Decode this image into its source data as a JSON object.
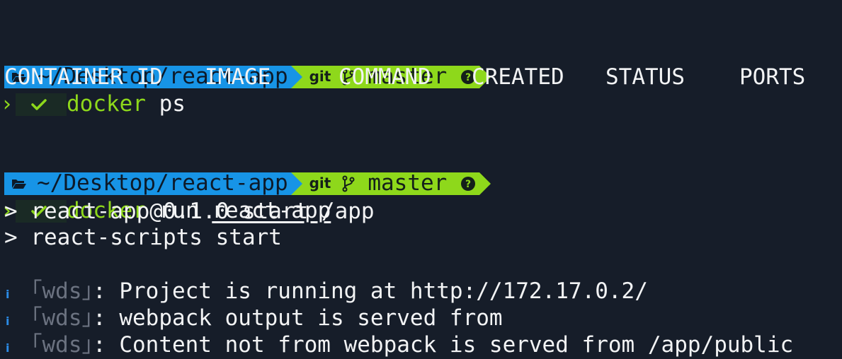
{
  "prompt1": {
    "path": "~/Desktop/react-app",
    "vcs": "git",
    "branch": "master",
    "command_word": "docker",
    "command_rest": " ps"
  },
  "ps_header": [
    "CONTAINER ID",
    "IMAGE",
    "COMMAND",
    "CREATED",
    "STATUS",
    "PORTS"
  ],
  "prompt2": {
    "path": "~/Desktop/react-app",
    "vcs": "git",
    "branch": "master",
    "command_word": "docker",
    "command_mid": " run ",
    "command_arg": "react-app"
  },
  "output": {
    "line1": "> react-app@0.1.0 start /app",
    "line2": "> react-scripts start",
    "wds": [
      {
        "icon": "i",
        "tag_open": "｢",
        "tag": "wds",
        "tag_close": "｣",
        "text": ": Project is running at http://172.17.0.2/"
      },
      {
        "icon": "i",
        "tag_open": "｢",
        "tag": "wds",
        "tag_close": "｣",
        "text": ": webpack output is served from"
      },
      {
        "icon": "i",
        "tag_open": "｢",
        "tag": "wds",
        "tag_close": "｣",
        "text": ": Content not from webpack is served from /app/public"
      }
    ]
  },
  "colors": {
    "background": "#161d29",
    "path_segment": "#1794e6",
    "git_segment": "#8ed81b",
    "info_icon": "#2b8ce8"
  }
}
